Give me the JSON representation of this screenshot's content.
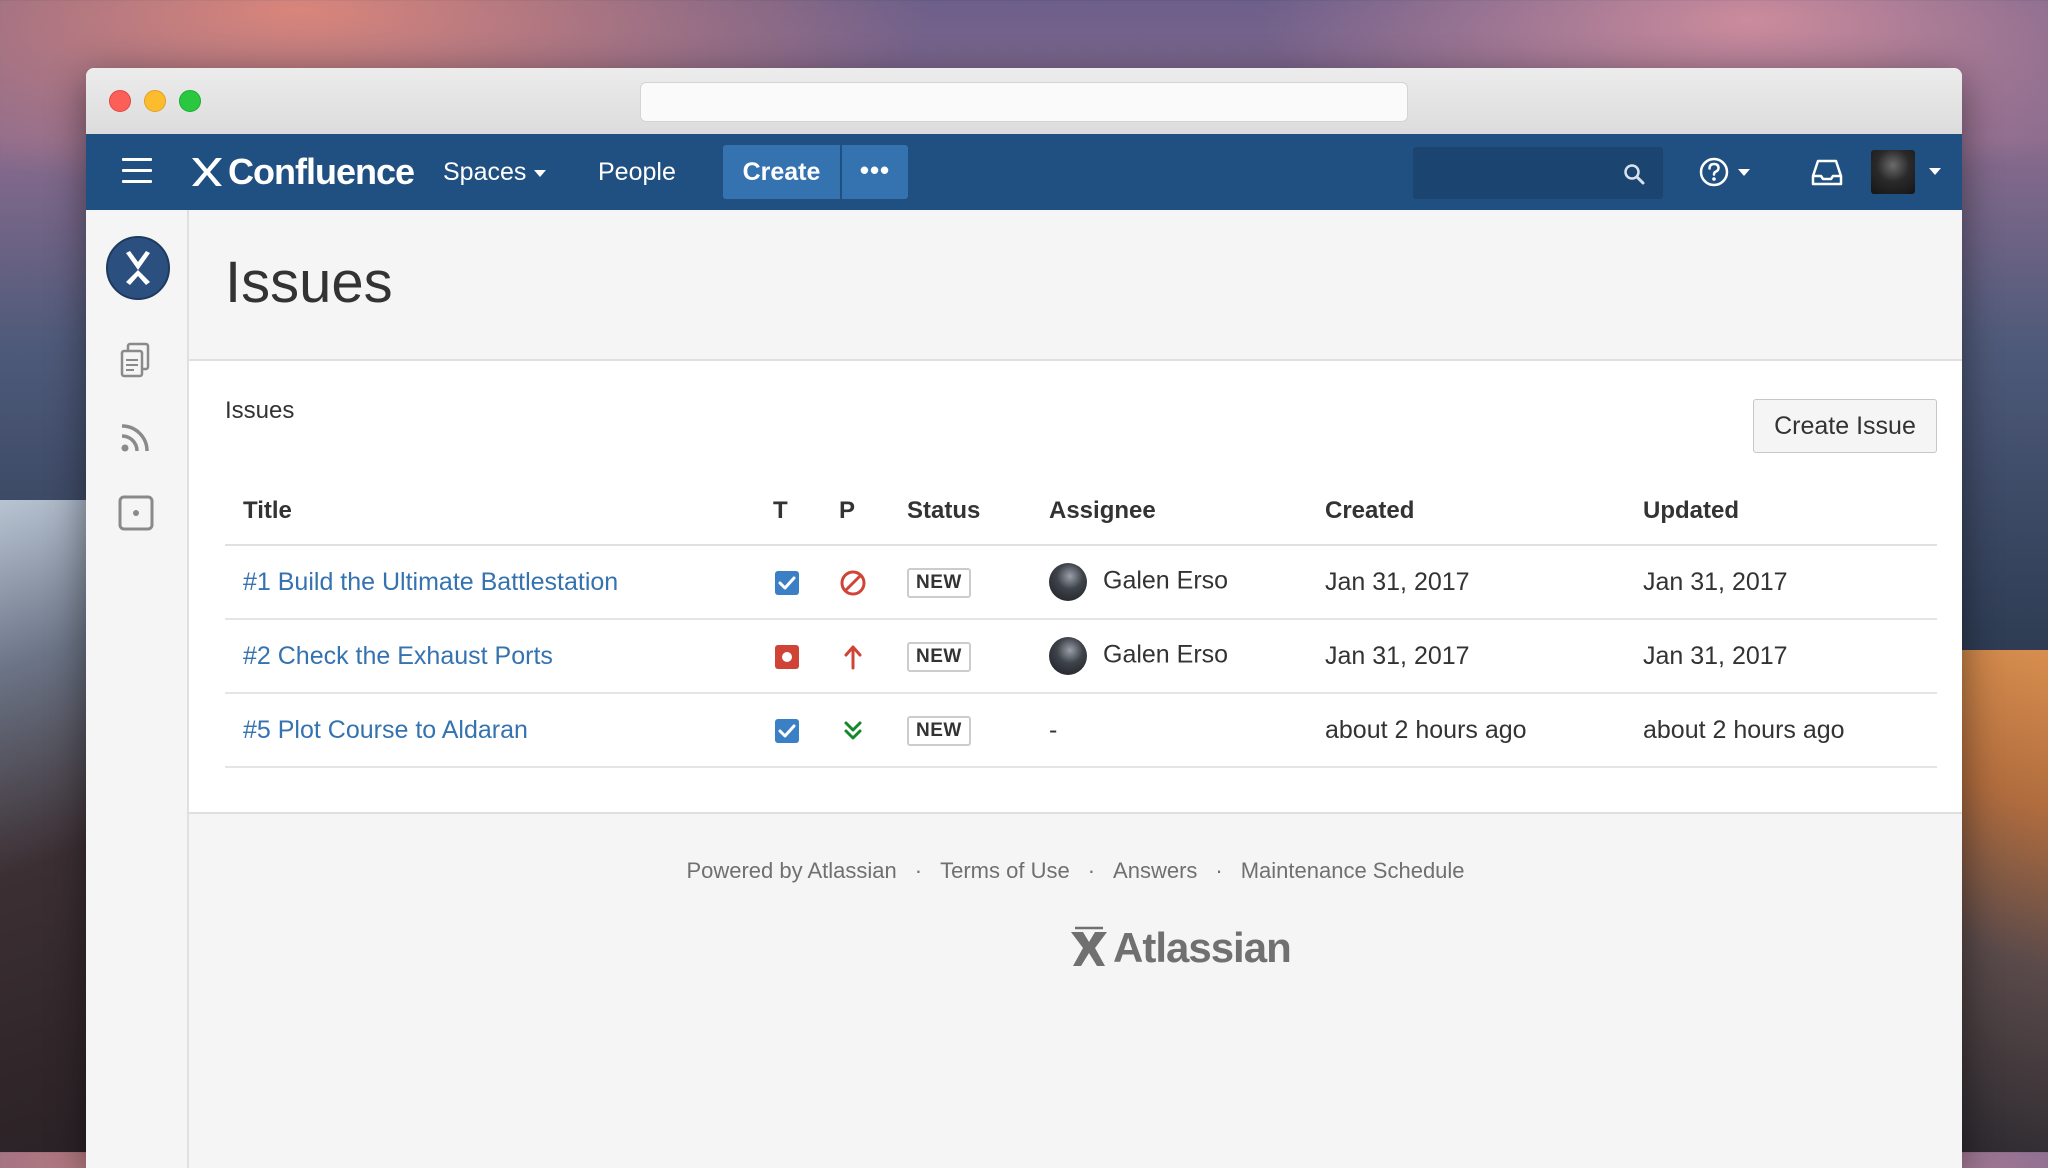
{
  "browser": {
    "url": ""
  },
  "navbar": {
    "logo_text": "Confluence",
    "spaces_label": "Spaces",
    "people_label": "People",
    "create_label": "Create",
    "more_label": "•••",
    "search_placeholder": ""
  },
  "page": {
    "title": "Issues"
  },
  "content": {
    "section_label": "Issues",
    "create_issue_label": "Create Issue",
    "columns": [
      "Title",
      "T",
      "P",
      "Status",
      "Assignee",
      "Created",
      "Updated"
    ],
    "rows": [
      {
        "title": "#1 Build the Ultimate Battlestation",
        "type_icon": "checkbox-checked-icon",
        "priority_icon": "blocker-icon",
        "status": "NEW",
        "assignee": "Galen Erso",
        "created": "Jan 31, 2017",
        "updated": "Jan 31, 2017"
      },
      {
        "title": "#2 Check the Exhaust Ports",
        "type_icon": "bug-icon",
        "priority_icon": "arrow-up-icon",
        "status": "NEW",
        "assignee": "Galen Erso",
        "created": "Jan 31, 2017",
        "updated": "Jan 31, 2017"
      },
      {
        "title": "#5 Plot Course to Aldaran",
        "type_icon": "checkbox-checked-icon",
        "priority_icon": "double-chevron-down-icon",
        "status": "NEW",
        "assignee": "-",
        "created": "about 2 hours ago",
        "updated": "about 2 hours ago"
      }
    ]
  },
  "footer": {
    "links": [
      "Powered by Atlassian",
      "Terms of Use",
      "Answers",
      "Maintenance Schedule"
    ],
    "separator": "·",
    "brand": "Atlassian"
  },
  "colors": {
    "navbar": "#205081",
    "create_button": "#3572b0",
    "link": "#3572b0",
    "blocker": "#d04437",
    "bug": "#d04437",
    "task": "#3b7fc4",
    "low_priority": "#14892c"
  }
}
